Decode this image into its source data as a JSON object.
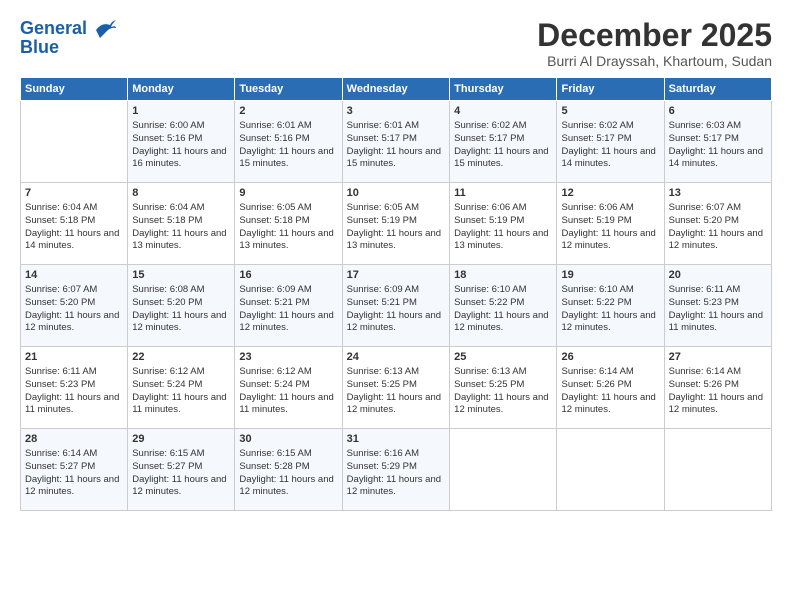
{
  "header": {
    "logo_line1": "General",
    "logo_line2": "Blue",
    "title": "December 2025",
    "subtitle": "Burri Al Drayssah, Khartoum, Sudan"
  },
  "days_of_week": [
    "Sunday",
    "Monday",
    "Tuesday",
    "Wednesday",
    "Thursday",
    "Friday",
    "Saturday"
  ],
  "weeks": [
    [
      {
        "num": "",
        "sunrise": "",
        "sunset": "",
        "daylight": ""
      },
      {
        "num": "1",
        "sunrise": "Sunrise: 6:00 AM",
        "sunset": "Sunset: 5:16 PM",
        "daylight": "Daylight: 11 hours and 16 minutes."
      },
      {
        "num": "2",
        "sunrise": "Sunrise: 6:01 AM",
        "sunset": "Sunset: 5:16 PM",
        "daylight": "Daylight: 11 hours and 15 minutes."
      },
      {
        "num": "3",
        "sunrise": "Sunrise: 6:01 AM",
        "sunset": "Sunset: 5:17 PM",
        "daylight": "Daylight: 11 hours and 15 minutes."
      },
      {
        "num": "4",
        "sunrise": "Sunrise: 6:02 AM",
        "sunset": "Sunset: 5:17 PM",
        "daylight": "Daylight: 11 hours and 15 minutes."
      },
      {
        "num": "5",
        "sunrise": "Sunrise: 6:02 AM",
        "sunset": "Sunset: 5:17 PM",
        "daylight": "Daylight: 11 hours and 14 minutes."
      },
      {
        "num": "6",
        "sunrise": "Sunrise: 6:03 AM",
        "sunset": "Sunset: 5:17 PM",
        "daylight": "Daylight: 11 hours and 14 minutes."
      }
    ],
    [
      {
        "num": "7",
        "sunrise": "Sunrise: 6:04 AM",
        "sunset": "Sunset: 5:18 PM",
        "daylight": "Daylight: 11 hours and 14 minutes."
      },
      {
        "num": "8",
        "sunrise": "Sunrise: 6:04 AM",
        "sunset": "Sunset: 5:18 PM",
        "daylight": "Daylight: 11 hours and 13 minutes."
      },
      {
        "num": "9",
        "sunrise": "Sunrise: 6:05 AM",
        "sunset": "Sunset: 5:18 PM",
        "daylight": "Daylight: 11 hours and 13 minutes."
      },
      {
        "num": "10",
        "sunrise": "Sunrise: 6:05 AM",
        "sunset": "Sunset: 5:19 PM",
        "daylight": "Daylight: 11 hours and 13 minutes."
      },
      {
        "num": "11",
        "sunrise": "Sunrise: 6:06 AM",
        "sunset": "Sunset: 5:19 PM",
        "daylight": "Daylight: 11 hours and 13 minutes."
      },
      {
        "num": "12",
        "sunrise": "Sunrise: 6:06 AM",
        "sunset": "Sunset: 5:19 PM",
        "daylight": "Daylight: 11 hours and 12 minutes."
      },
      {
        "num": "13",
        "sunrise": "Sunrise: 6:07 AM",
        "sunset": "Sunset: 5:20 PM",
        "daylight": "Daylight: 11 hours and 12 minutes."
      }
    ],
    [
      {
        "num": "14",
        "sunrise": "Sunrise: 6:07 AM",
        "sunset": "Sunset: 5:20 PM",
        "daylight": "Daylight: 11 hours and 12 minutes."
      },
      {
        "num": "15",
        "sunrise": "Sunrise: 6:08 AM",
        "sunset": "Sunset: 5:20 PM",
        "daylight": "Daylight: 11 hours and 12 minutes."
      },
      {
        "num": "16",
        "sunrise": "Sunrise: 6:09 AM",
        "sunset": "Sunset: 5:21 PM",
        "daylight": "Daylight: 11 hours and 12 minutes."
      },
      {
        "num": "17",
        "sunrise": "Sunrise: 6:09 AM",
        "sunset": "Sunset: 5:21 PM",
        "daylight": "Daylight: 11 hours and 12 minutes."
      },
      {
        "num": "18",
        "sunrise": "Sunrise: 6:10 AM",
        "sunset": "Sunset: 5:22 PM",
        "daylight": "Daylight: 11 hours and 12 minutes."
      },
      {
        "num": "19",
        "sunrise": "Sunrise: 6:10 AM",
        "sunset": "Sunset: 5:22 PM",
        "daylight": "Daylight: 11 hours and 12 minutes."
      },
      {
        "num": "20",
        "sunrise": "Sunrise: 6:11 AM",
        "sunset": "Sunset: 5:23 PM",
        "daylight": "Daylight: 11 hours and 11 minutes."
      }
    ],
    [
      {
        "num": "21",
        "sunrise": "Sunrise: 6:11 AM",
        "sunset": "Sunset: 5:23 PM",
        "daylight": "Daylight: 11 hours and 11 minutes."
      },
      {
        "num": "22",
        "sunrise": "Sunrise: 6:12 AM",
        "sunset": "Sunset: 5:24 PM",
        "daylight": "Daylight: 11 hours and 11 minutes."
      },
      {
        "num": "23",
        "sunrise": "Sunrise: 6:12 AM",
        "sunset": "Sunset: 5:24 PM",
        "daylight": "Daylight: 11 hours and 11 minutes."
      },
      {
        "num": "24",
        "sunrise": "Sunrise: 6:13 AM",
        "sunset": "Sunset: 5:25 PM",
        "daylight": "Daylight: 11 hours and 12 minutes."
      },
      {
        "num": "25",
        "sunrise": "Sunrise: 6:13 AM",
        "sunset": "Sunset: 5:25 PM",
        "daylight": "Daylight: 11 hours and 12 minutes."
      },
      {
        "num": "26",
        "sunrise": "Sunrise: 6:14 AM",
        "sunset": "Sunset: 5:26 PM",
        "daylight": "Daylight: 11 hours and 12 minutes."
      },
      {
        "num": "27",
        "sunrise": "Sunrise: 6:14 AM",
        "sunset": "Sunset: 5:26 PM",
        "daylight": "Daylight: 11 hours and 12 minutes."
      }
    ],
    [
      {
        "num": "28",
        "sunrise": "Sunrise: 6:14 AM",
        "sunset": "Sunset: 5:27 PM",
        "daylight": "Daylight: 11 hours and 12 minutes."
      },
      {
        "num": "29",
        "sunrise": "Sunrise: 6:15 AM",
        "sunset": "Sunset: 5:27 PM",
        "daylight": "Daylight: 11 hours and 12 minutes."
      },
      {
        "num": "30",
        "sunrise": "Sunrise: 6:15 AM",
        "sunset": "Sunset: 5:28 PM",
        "daylight": "Daylight: 11 hours and 12 minutes."
      },
      {
        "num": "31",
        "sunrise": "Sunrise: 6:16 AM",
        "sunset": "Sunset: 5:29 PM",
        "daylight": "Daylight: 11 hours and 12 minutes."
      },
      {
        "num": "",
        "sunrise": "",
        "sunset": "",
        "daylight": ""
      },
      {
        "num": "",
        "sunrise": "",
        "sunset": "",
        "daylight": ""
      },
      {
        "num": "",
        "sunrise": "",
        "sunset": "",
        "daylight": ""
      }
    ]
  ]
}
